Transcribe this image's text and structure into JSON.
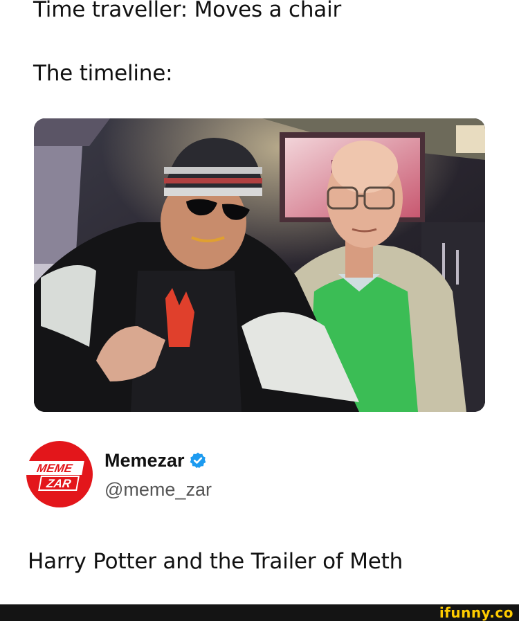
{
  "post": {
    "line1": "Time traveller: Moves a chair",
    "line2": "The timeline:",
    "caption": "Harry Potter and the Trailer of Meth"
  },
  "account": {
    "display_name": "Memezar",
    "handle": "@meme_zar",
    "avatar_text_top": "MEME",
    "avatar_text_bottom": "ZAR",
    "avatar_color": "#e3161b",
    "verified": true,
    "verified_color": "#1d9bf0"
  },
  "photo": {
    "icon": "photo-two-men"
  },
  "watermark": {
    "text": "ifunny.co",
    "color": "#ffcc00"
  }
}
